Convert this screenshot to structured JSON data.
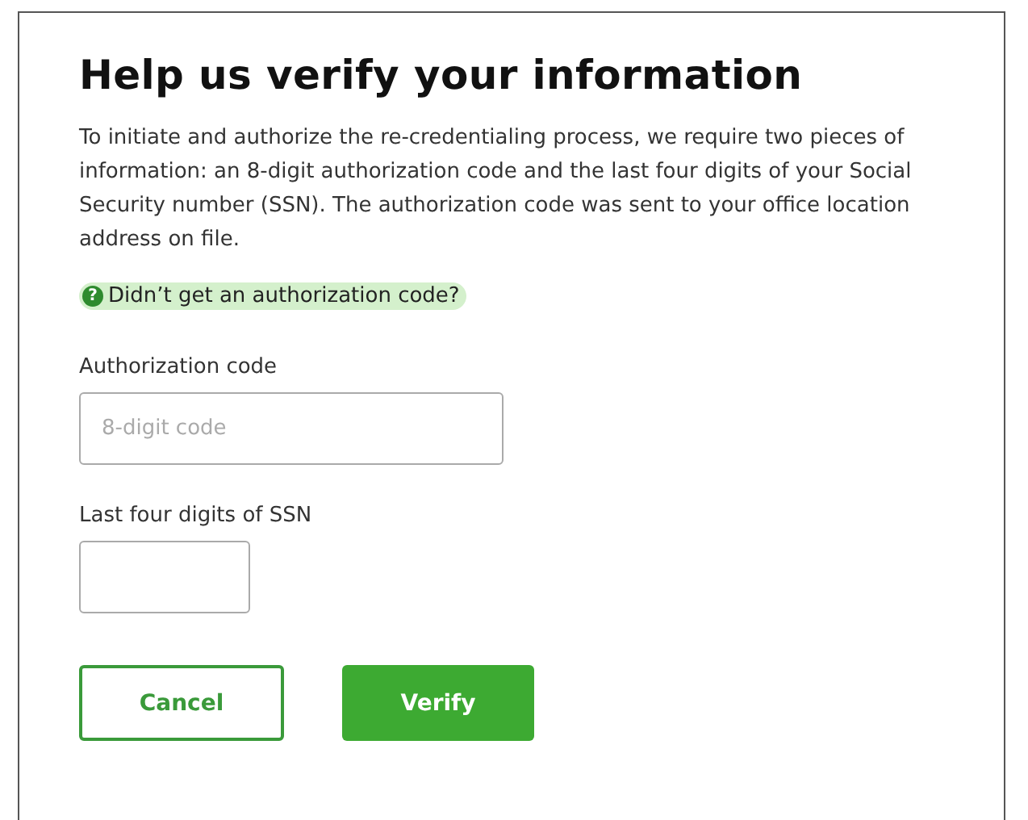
{
  "title": "Help us verify your information",
  "description": "To initiate and authorize the re-credentialing process, we require two pieces of information: an 8-digit authorization code and the last four digits of your Social Security number (SSN). The authorization code was sent to your office location address on file.",
  "help_link": {
    "icon": "?",
    "label": "Didn’t get an authorization code?"
  },
  "fields": [
    {
      "label": "Authorization code",
      "placeholder": "8-digit code",
      "kind": "wide"
    },
    {
      "label": "Last four digits of SSN",
      "kind": "short"
    }
  ],
  "buttons": [
    {
      "label": "Cancel",
      "kind": "secondary"
    },
    {
      "label": "Verify",
      "kind": "primary"
    }
  ]
}
